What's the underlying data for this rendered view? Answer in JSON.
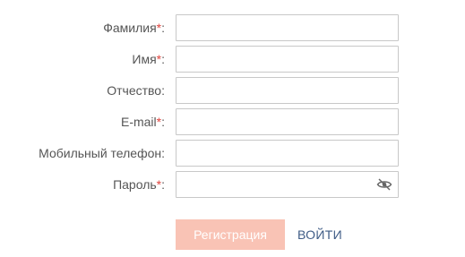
{
  "form": {
    "fields": [
      {
        "label": "Фамилия",
        "required": true,
        "value": ""
      },
      {
        "label": "Имя",
        "required": true,
        "value": ""
      },
      {
        "label": "Отчество",
        "required": false,
        "value": ""
      },
      {
        "label": "E-mail",
        "required": true,
        "value": ""
      },
      {
        "label": "Мобильный телефон",
        "required": false,
        "value": ""
      },
      {
        "label": "Пароль",
        "required": true,
        "value": ""
      }
    ],
    "required_mark": "*",
    "colon": ":",
    "password_toggle_icon": "eye-slash-icon",
    "register_label": "Регистрация",
    "login_label": "ВОЙТИ"
  },
  "colors": {
    "required": "#e0443e",
    "register_button": "#f9c3b5",
    "login_link": "#3f5c86"
  }
}
